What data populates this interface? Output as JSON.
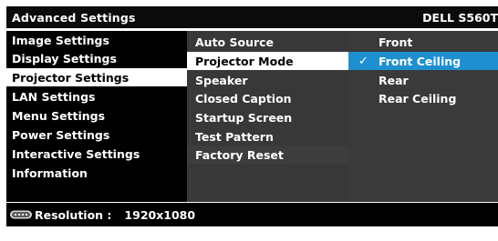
{
  "header": {
    "title": "Advanced Settings",
    "model": "DELL S560T"
  },
  "main_menu": {
    "items": [
      {
        "label": "Image Settings",
        "state": "normal"
      },
      {
        "label": "Display Settings",
        "state": "normal"
      },
      {
        "label": "Projector Settings",
        "state": "selected"
      },
      {
        "label": "LAN Settings",
        "state": "normal"
      },
      {
        "label": "Menu Settings",
        "state": "normal"
      },
      {
        "label": "Power Settings",
        "state": "normal"
      },
      {
        "label": "Interactive Settings",
        "state": "normal"
      },
      {
        "label": "Information",
        "state": "normal"
      }
    ]
  },
  "sub_menu": {
    "items": [
      {
        "label": "Auto Source",
        "state": "normal"
      },
      {
        "label": "Projector Mode",
        "state": "selected"
      },
      {
        "label": "Speaker",
        "state": "normal"
      },
      {
        "label": "Closed Caption",
        "state": "normal"
      },
      {
        "label": "Startup Screen",
        "state": "normal"
      },
      {
        "label": "Test Pattern",
        "state": "normal"
      },
      {
        "label": "Factory Reset",
        "state": "normal"
      }
    ]
  },
  "options": {
    "items": [
      {
        "label": "Front",
        "checked": false,
        "state": "normal"
      },
      {
        "label": "Front Ceiling",
        "checked": true,
        "state": "active"
      },
      {
        "label": "Rear",
        "checked": false,
        "state": "normal"
      },
      {
        "label": "Rear Ceiling",
        "checked": false,
        "state": "normal"
      }
    ],
    "check_glyph": "✓"
  },
  "footer": {
    "icon": "display-port-icon",
    "resolution_label": "Resolution :",
    "resolution_value": "1920x1080"
  },
  "colors": {
    "highlight_blue": "#1e90d0",
    "selected_white": "#ffffff",
    "panel_black": "#000000",
    "panel_gray": "#3a3a3a"
  }
}
